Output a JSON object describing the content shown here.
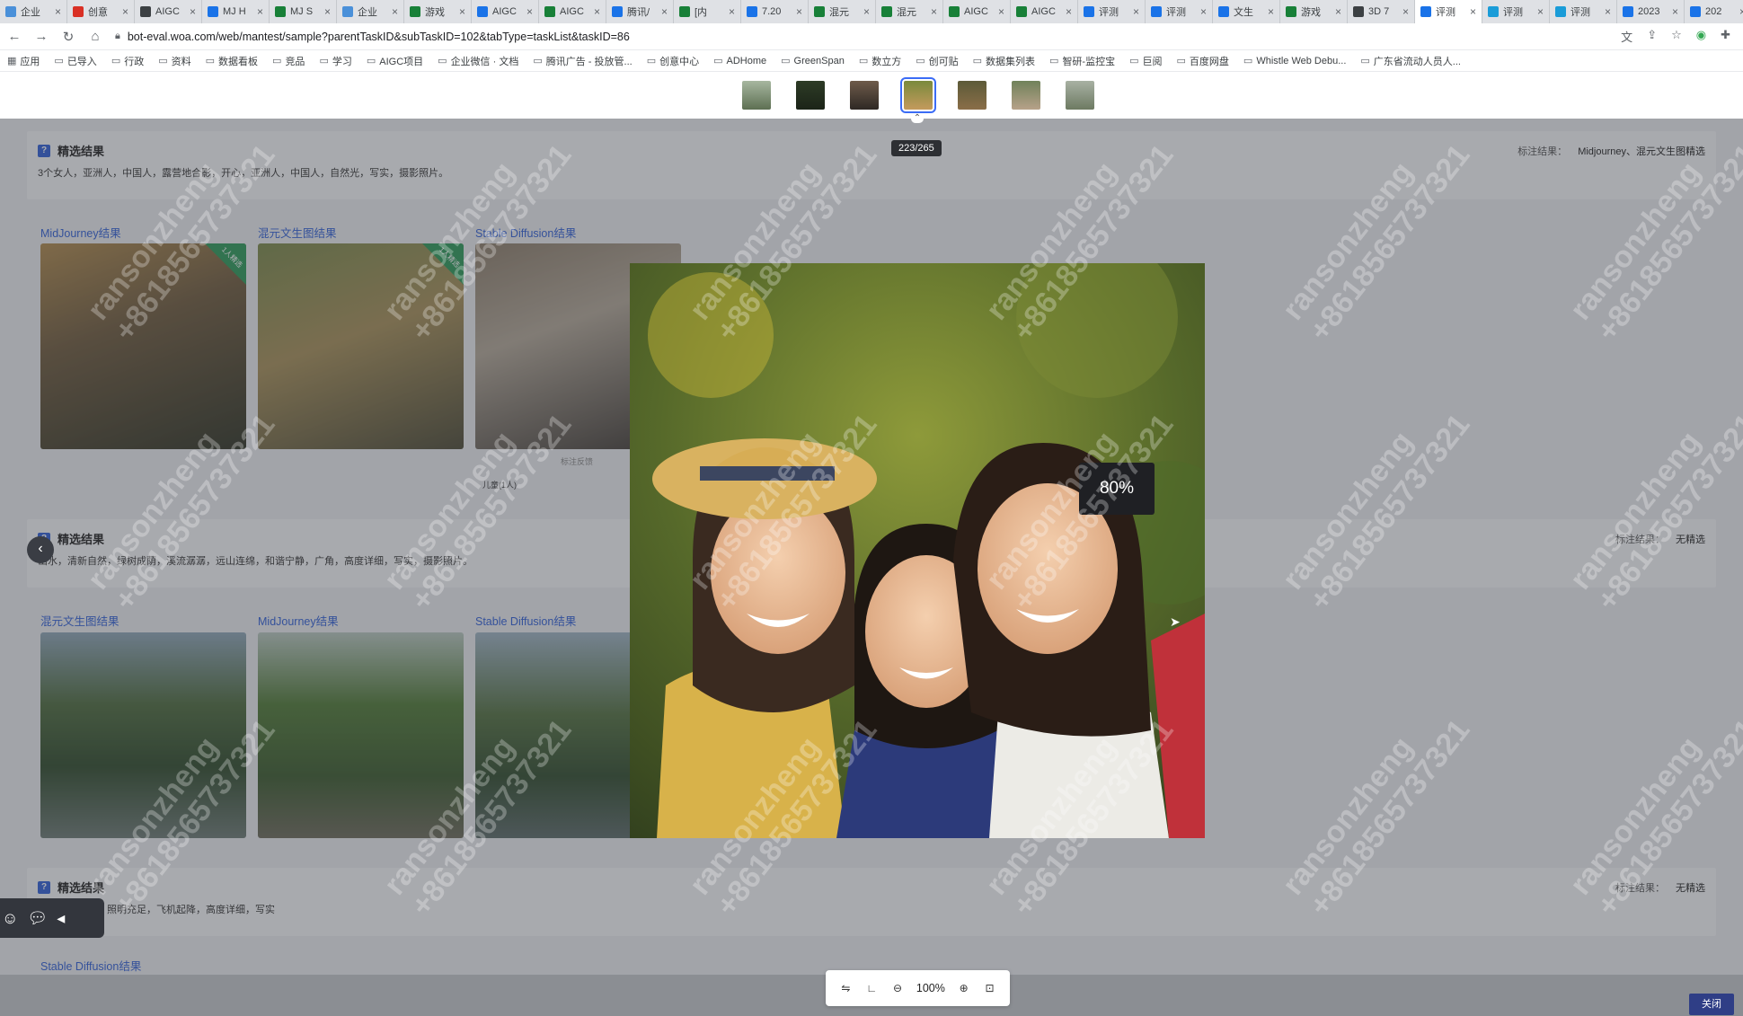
{
  "browser": {
    "tabs": [
      {
        "title": "企业",
        "color": "#4a90d9"
      },
      {
        "title": "创意",
        "color": "#d93025"
      },
      {
        "title": "AIGC",
        "color": "#3c4043"
      },
      {
        "title": "MJ H",
        "color": "#1a73e8"
      },
      {
        "title": "MJ S",
        "color": "#188038"
      },
      {
        "title": "企业",
        "color": "#4a90d9"
      },
      {
        "title": "游戏",
        "color": "#188038"
      },
      {
        "title": "AIGC",
        "color": "#1a73e8"
      },
      {
        "title": "AIGC",
        "color": "#188038"
      },
      {
        "title": "腾讯/",
        "color": "#1a73e8"
      },
      {
        "title": "[内",
        "color": "#188038"
      },
      {
        "title": "7.20",
        "color": "#1a73e8"
      },
      {
        "title": "混元",
        "color": "#188038"
      },
      {
        "title": "混元",
        "color": "#188038"
      },
      {
        "title": "AIGC",
        "color": "#188038"
      },
      {
        "title": "AIGC",
        "color": "#188038"
      },
      {
        "title": "评测",
        "color": "#1a73e8"
      },
      {
        "title": "评测",
        "color": "#1a73e8"
      },
      {
        "title": "文生",
        "color": "#1a73e8"
      },
      {
        "title": "游戏",
        "color": "#188038"
      },
      {
        "title": "3D 7",
        "color": "#3c4043"
      },
      {
        "title": "评测",
        "color": "#1a73e8"
      },
      {
        "title": "评测",
        "color": "#1a9cd8"
      },
      {
        "title": "评测",
        "color": "#1a9cd8"
      },
      {
        "title": "2023",
        "color": "#1a73e8"
      },
      {
        "title": "202",
        "color": "#1a73e8"
      }
    ],
    "active_tab_index": 21,
    "url": "bot-eval.woa.com/web/mantest/sample?parentTaskID&subTaskID=102&tabType=taskList&taskID=86",
    "bookmarks": [
      "应用",
      "已导入",
      "行政",
      "资料",
      "数据看板",
      "竞品",
      "学习",
      "AIGC项目",
      "企业微信 · 文档",
      "腾讯广告 - 投放管...",
      "创意中心",
      "ADHome",
      "GreenSpan",
      "数立方",
      "创可贴",
      "数据集列表",
      "智研-监控宝",
      "巨阅",
      "百度网盘",
      "Whistle Web Debu...",
      "广东省流动人员人..."
    ]
  },
  "viewer": {
    "counter": "223/265",
    "percent_badge": "80%",
    "zoom_level": "100%",
    "close_label": "关闭"
  },
  "sections": [
    {
      "title": "精选结果",
      "description": "3个女人，亚洲人，中国人，露营地合影，开心，亚洲人，中国人，自然光，写实，摄影照片。",
      "result_label": "标注结果：",
      "result_value": "Midjourney、混元文生图精选",
      "columns": [
        "MidJourney结果",
        "混元文生图结果",
        "Stable Diffusion结果"
      ],
      "badge_text": "1人精选",
      "feedback_label": "标注反馈",
      "tag_label": "儿童(1人)"
    },
    {
      "title": "精选结果",
      "description": "山水，清新自然，绿树成荫，溪流潺潺，远山连绵，和谐宁静，广角，高度详细，写实，摄影照片。",
      "result_label": "标注结果：",
      "result_value": "无精选",
      "columns": [
        "混元文生图结果",
        "MidJourney结果",
        "Stable Diffusion结果"
      ]
    },
    {
      "title": "精选结果",
      "description": "飞机场，夜晚，照明充足，飞机起降，高度详细，写实",
      "result_label": "标注结果：",
      "result_value": "无精选",
      "columns": [
        "Stable Diffusion结果"
      ]
    }
  ],
  "watermark": {
    "name": "ransonzheng",
    "id": "+8618565737321"
  }
}
